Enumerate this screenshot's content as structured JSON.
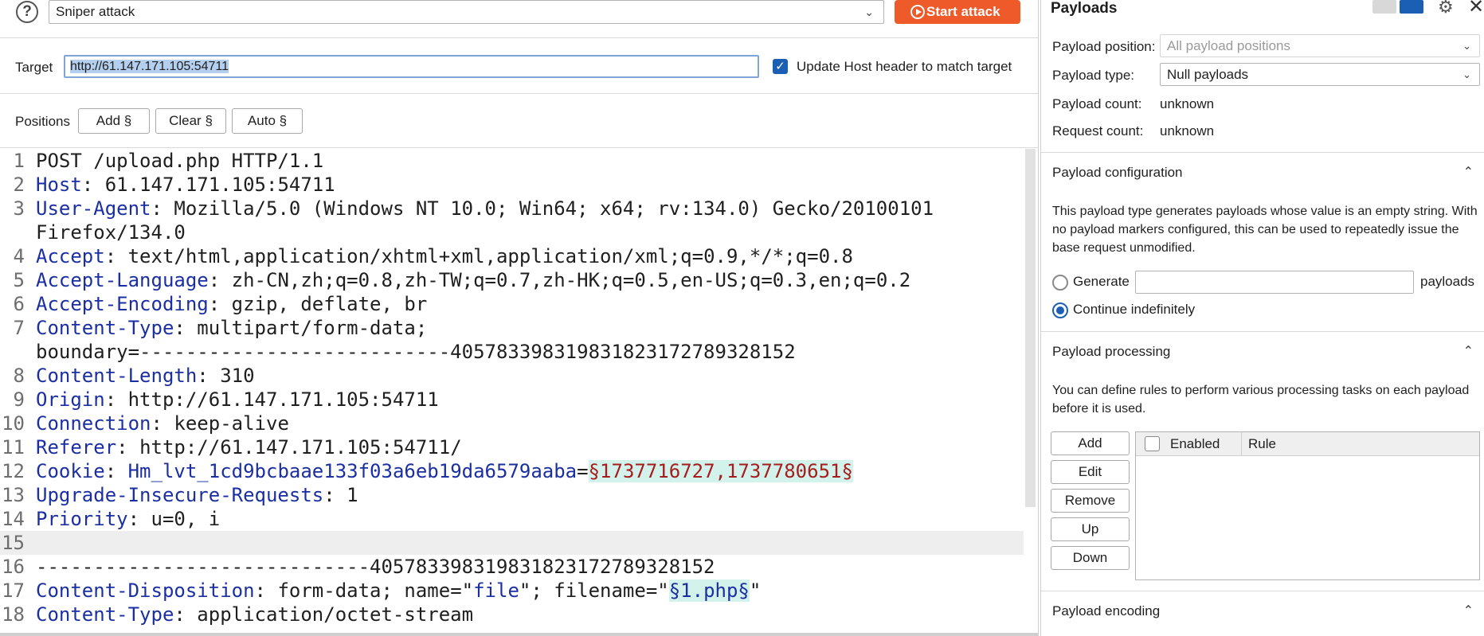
{
  "top": {
    "help_icon": "?",
    "attack_type": "Sniper attack",
    "start_button": "Start attack"
  },
  "target": {
    "label": "Target",
    "value": "http://61.147.171.105:54711",
    "update_host_label": "Update Host header to match target",
    "update_host_checked": true
  },
  "positions": {
    "label": "Positions",
    "add": "Add §",
    "clear": "Clear §",
    "auto": "Auto §"
  },
  "request_lines": [
    {
      "n": "1",
      "key": "",
      "sep": "",
      "val": "POST /upload.php HTTP/1.1"
    },
    {
      "n": "2",
      "key": "Host",
      "sep": ": ",
      "val": "61.147.171.105:54711"
    },
    {
      "n": "3",
      "key": "User-Agent",
      "sep": ": ",
      "val": "Mozilla/5.0 (Windows NT 10.0; Win64; x64; rv:134.0) Gecko/20100101"
    },
    {
      "n": "",
      "key": "",
      "sep": "",
      "val": "Firefox/134.0"
    },
    {
      "n": "4",
      "key": "Accept",
      "sep": ": ",
      "val": "text/html,application/xhtml+xml,application/xml;q=0.9,*/*;q=0.8"
    },
    {
      "n": "5",
      "key": "Accept-Language",
      "sep": ": ",
      "val": "zh-CN,zh;q=0.8,zh-TW;q=0.7,zh-HK;q=0.5,en-US;q=0.3,en;q=0.2"
    },
    {
      "n": "6",
      "key": "Accept-Encoding",
      "sep": ": ",
      "val": "gzip, deflate, br"
    },
    {
      "n": "7",
      "key": "Content-Type",
      "sep": ": ",
      "val": "multipart/form-data;"
    },
    {
      "n": "",
      "key": "",
      "sep": "",
      "val": "boundary=---------------------------405783398319831823172789328152"
    },
    {
      "n": "8",
      "key": "Content-Length",
      "sep": ": ",
      "val": "310"
    },
    {
      "n": "9",
      "key": "Origin",
      "sep": ": ",
      "val": "http://61.147.171.105:54711"
    },
    {
      "n": "10",
      "key": "Connection",
      "sep": ": ",
      "val": "keep-alive"
    },
    {
      "n": "11",
      "key": "Referer",
      "sep": ": ",
      "val": "http://61.147.171.105:54711/"
    },
    {
      "n": "12",
      "key": "Cookie",
      "sep": ": ",
      "val": "",
      "cookie_name": "Hm_lvt_1cd9bcbaae133f03a6eb19da6579aaba",
      "cookie_eq": "=",
      "marker": "§1737716727,1737780651§"
    },
    {
      "n": "13",
      "key": "Upgrade-Insecure-Requests",
      "sep": ": ",
      "val": "1"
    },
    {
      "n": "14",
      "key": "Priority",
      "sep": ": ",
      "val": "u=0, i"
    },
    {
      "n": "15",
      "key": "",
      "sep": "",
      "val": "",
      "highlight": true
    },
    {
      "n": "16",
      "key": "",
      "sep": "",
      "val": "-----------------------------405783398319831823172789328152"
    },
    {
      "n": "17",
      "key": "Content-Disposition",
      "sep": ": ",
      "val": "form-data; name=\"",
      "name_val": "file",
      "mid": "\"; filename=\"",
      "marker2": "§1.php§",
      "end": "\""
    },
    {
      "n": "18",
      "key": "Content-Type",
      "sep": ": ",
      "val": "application/octet-stream"
    }
  ],
  "payloads": {
    "title": "Payloads",
    "position_label": "Payload position:",
    "position_value": "All payload positions",
    "type_label": "Payload type:",
    "type_value": "Null payloads",
    "count_label": "Payload count:",
    "count_value": "unknown",
    "request_label": "Request count:",
    "request_value": "unknown"
  },
  "configuration": {
    "title": "Payload configuration",
    "description": "This payload type generates payloads whose value is an empty string. With no payload markers configured, this can be used to repeatedly issue the base request unmodified.",
    "generate_label": "Generate",
    "generate_value": "",
    "generate_suffix": "payloads",
    "continue_label": "Continue indefinitely",
    "selected": "continue"
  },
  "processing": {
    "title": "Payload processing",
    "description": "You can define rules to perform various processing tasks on each payload before it is used.",
    "buttons": [
      "Add",
      "Edit",
      "Remove",
      "Up",
      "Down"
    ],
    "columns": [
      "Enabled",
      "Rule"
    ],
    "rules": []
  },
  "encoding": {
    "title": "Payload encoding"
  },
  "colors": {
    "accent": "#1a5fb4",
    "start_button": "#ee5a2a",
    "header_key": "#1b2fa3",
    "marker_text": "#a51d1d",
    "marker_bg": "#d4f2ec"
  }
}
